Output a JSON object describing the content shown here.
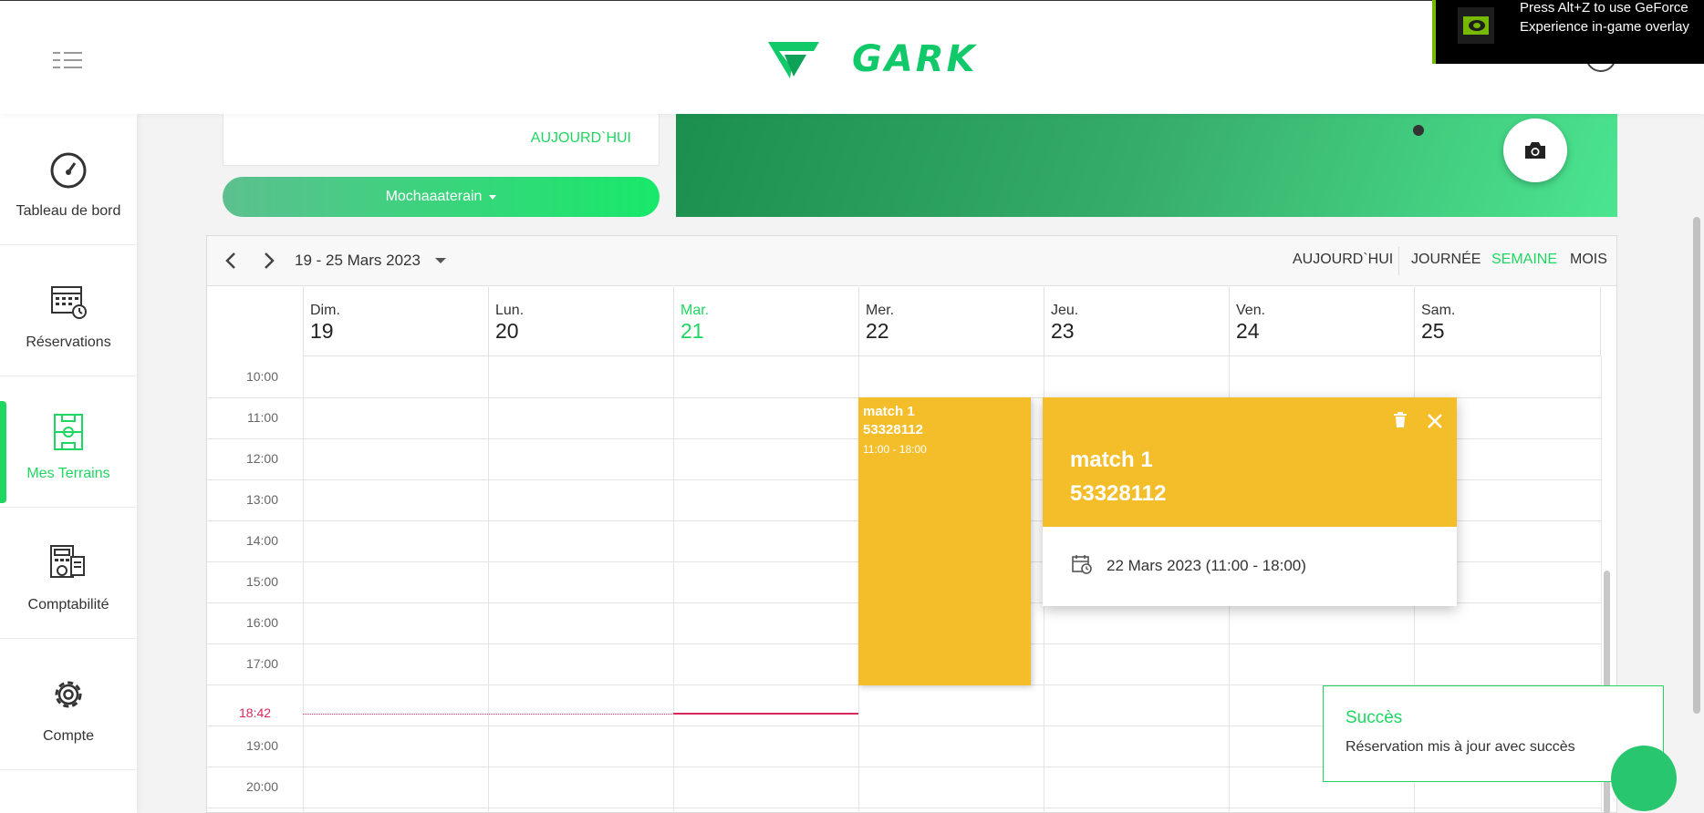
{
  "header": {
    "brand": "GARK"
  },
  "overlay": {
    "text": "Press Alt+Z to use GeForce Experience in-game overlay"
  },
  "sidebar": {
    "items": [
      {
        "label": "Tableau de bord",
        "icon": "dashboard-gauge-icon"
      },
      {
        "label": "Réservations",
        "icon": "calendar-clock-icon"
      },
      {
        "label": "Mes Terrains",
        "icon": "soccer-field-icon"
      },
      {
        "label": "Comptabilité",
        "icon": "accounting-calculator-icon"
      },
      {
        "label": "Compte",
        "icon": "gear-icon"
      }
    ],
    "active_index": 2
  },
  "top_card": {
    "today_label": "AUJOURD`HUI"
  },
  "terrain_select": {
    "label": "Mochaaaterain"
  },
  "calendar": {
    "range": "19 - 25 Mars 2023",
    "views": {
      "today": "AUJOURD`HUI",
      "day": "JOURNÉE",
      "week": "SEMAINE",
      "month": "MOIS"
    },
    "active_view": "SEMAINE",
    "days": [
      {
        "name": "Dim.",
        "date": "19"
      },
      {
        "name": "Lun.",
        "date": "20"
      },
      {
        "name": "Mar.",
        "date": "21"
      },
      {
        "name": "Mer.",
        "date": "22"
      },
      {
        "name": "Jeu.",
        "date": "23"
      },
      {
        "name": "Ven.",
        "date": "24"
      },
      {
        "name": "Sam.",
        "date": "25"
      }
    ],
    "today_index": 2,
    "hours": [
      "10:00",
      "11:00",
      "12:00",
      "13:00",
      "14:00",
      "15:00",
      "16:00",
      "17:00",
      "19:00",
      "20:00"
    ],
    "now_time": "18:42",
    "event": {
      "title": "match 1",
      "phone": "53328112",
      "time": "11:00 - 18:00",
      "color": "#f4be2a"
    }
  },
  "popup": {
    "title": "match 1",
    "phone": "53328112",
    "date": "22 Mars 2023 (11:00 - 18:00)"
  },
  "toast": {
    "title": "Succès",
    "message": "Réservation mis à jour avec succès"
  },
  "colors": {
    "accent": "#1ed760",
    "event": "#f4be2a",
    "now": "#d6285b"
  }
}
